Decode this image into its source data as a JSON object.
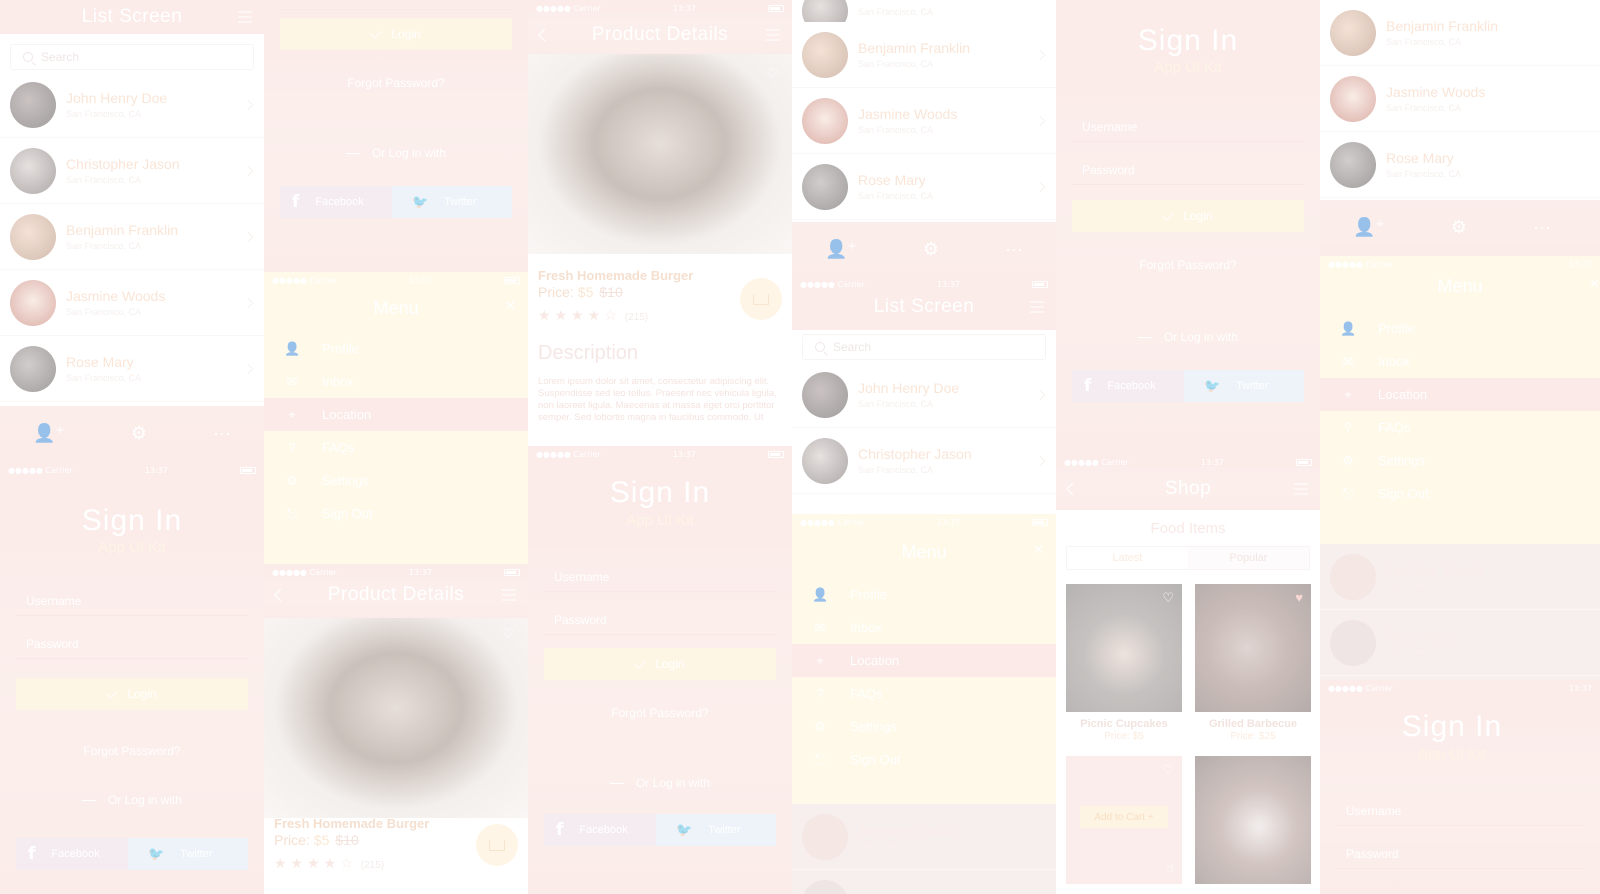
{
  "status": {
    "carrier": "●●●●● Carrier",
    "time": "13:37"
  },
  "list_screen": {
    "title": "List Screen",
    "search_placeholder": "Search"
  },
  "contacts": [
    {
      "name": "John Henry Doe",
      "location": "San Francisco, CA"
    },
    {
      "name": "Christopher Jason",
      "location": "San Francisco, CA"
    },
    {
      "name": "Benjamin Franklin",
      "location": "San Francisco, CA"
    },
    {
      "name": "Jasmine Woods",
      "location": "San Francisco, CA"
    },
    {
      "name": "Rose Mary",
      "location": "San Francisco, CA"
    }
  ],
  "signin": {
    "title": "Sign In",
    "subtitle": "App UI Kit",
    "username_placeholder": "Username",
    "password_placeholder": "Password",
    "login_label": "Login",
    "forgot_label": "Forgot Password?",
    "or_label": "Or Log in with",
    "facebook_label": "Facebook",
    "twitter_label": "Twitter"
  },
  "menu": {
    "title": "Menu",
    "items": [
      "Profile",
      "Inbox",
      "Location",
      "FAQs",
      "Settings",
      "Sign Out"
    ]
  },
  "product": {
    "title": "Product Details",
    "name": "Fresh Homemade Burger",
    "price_label": "Price:",
    "price_now": "$5",
    "price_old": "$10",
    "rating_count": "(215)",
    "description_title": "Description",
    "description": "Lorem ipsum dolor sit amet, consectetur adipiscing elit. Suspendisse sed leo tellus. Praesent nec vehicula ligula, non laoreet ligula. Maecenas at massa eget orci porttitor semper. Sed lobortis magna in faucibus commodo. Ut"
  },
  "shop": {
    "title": "Shop",
    "section": "Food Items",
    "tab_latest": "Latest",
    "tab_popular": "Popular",
    "items": [
      {
        "name": "Picnic Cupcakes",
        "price": "Price: $5"
      },
      {
        "name": "Grilled Barbecue",
        "price": "Price: $25"
      }
    ],
    "add_to_cart": "Add to Cart +"
  },
  "colors": {
    "accent": "#f7b27a",
    "bg_red": "#f5d3cf",
    "bg_yellow": "#fdf2cf"
  }
}
